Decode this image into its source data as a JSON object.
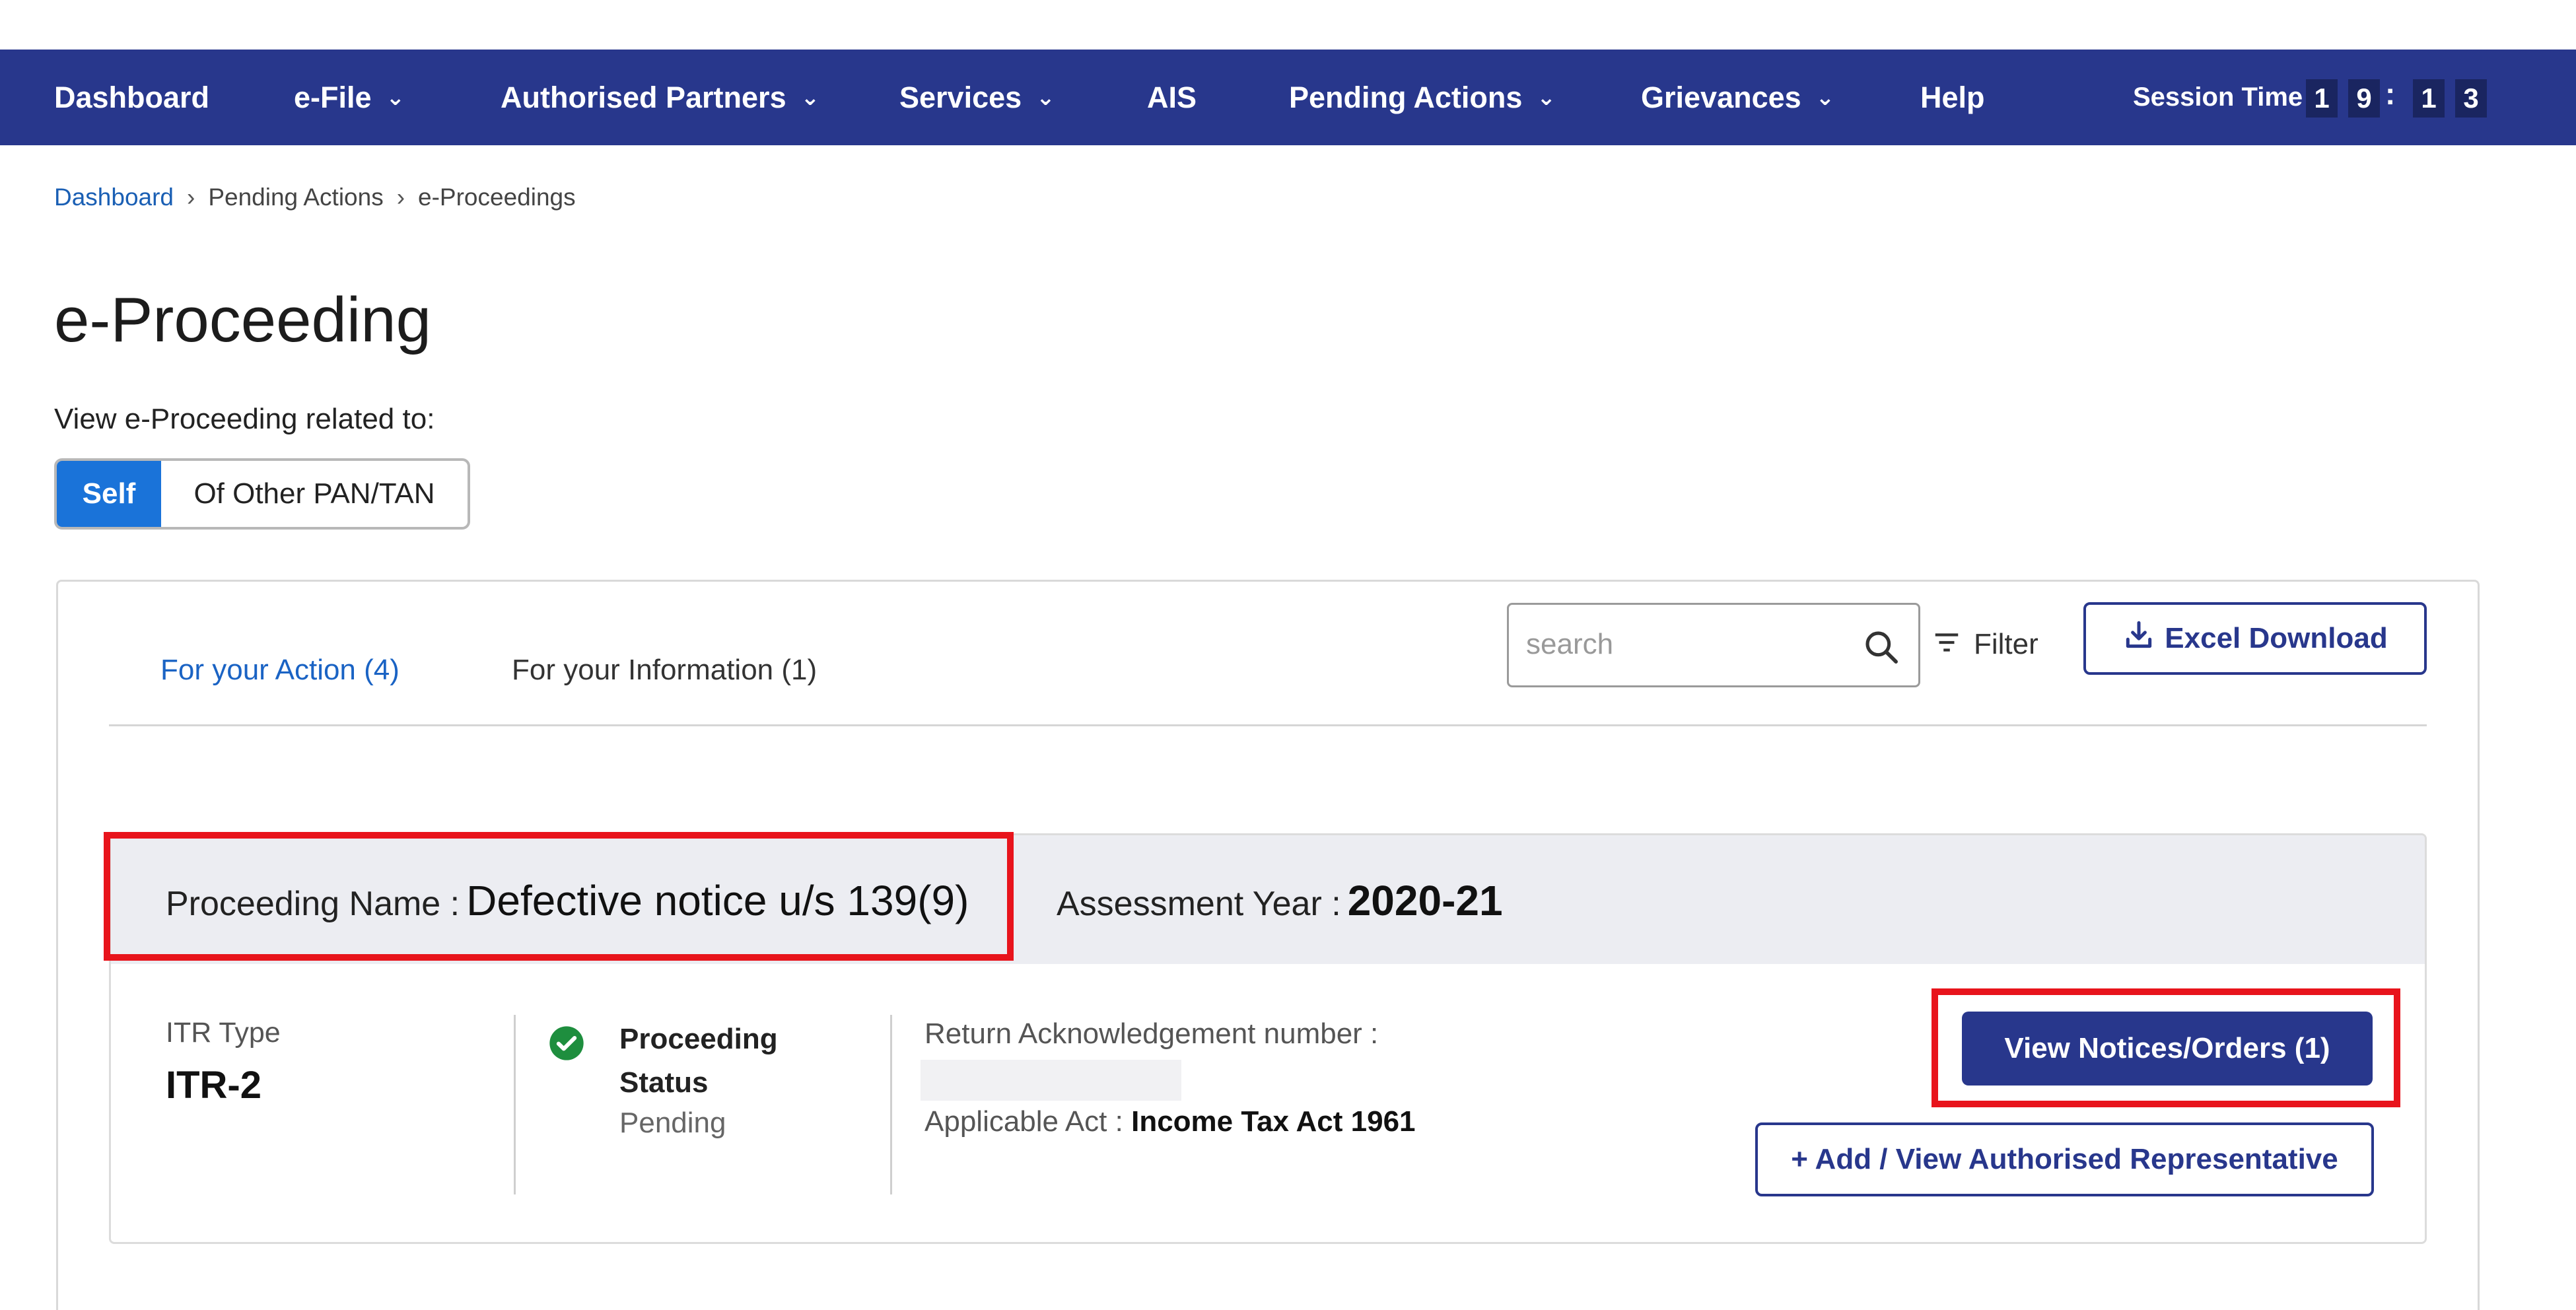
{
  "nav": {
    "items": [
      {
        "label": "Dashboard",
        "has_dropdown": false
      },
      {
        "label": "e-File",
        "has_dropdown": true
      },
      {
        "label": "Authorised Partners",
        "has_dropdown": true
      },
      {
        "label": "Services",
        "has_dropdown": true
      },
      {
        "label": "AIS",
        "has_dropdown": false
      },
      {
        "label": "Pending Actions",
        "has_dropdown": true
      },
      {
        "label": "Grievances",
        "has_dropdown": true
      },
      {
        "label": "Help",
        "has_dropdown": false
      }
    ],
    "session": {
      "label": "Session Time",
      "digits": [
        "1",
        "9",
        "1",
        "3"
      ],
      "separator": ":"
    }
  },
  "breadcrumb": {
    "items": [
      "Dashboard",
      "Pending Actions",
      "e-Proceedings"
    ],
    "separator": "›"
  },
  "page": {
    "title": "e-Proceeding",
    "view_label": "View e-Proceeding related to:"
  },
  "toggle": {
    "self": "Self",
    "other": "Of Other PAN/TAN"
  },
  "tabs": {
    "action": "For your Action (4)",
    "information": "For your Information (1)"
  },
  "toolbar": {
    "search_placeholder": "search",
    "filter": "Filter",
    "excel": "Excel Download"
  },
  "proceeding": {
    "name_label": "Proceeding Name :",
    "name_value": "Defective notice u/s 139(9)",
    "ay_label": "Assessment Year :",
    "ay_value": "2020-21",
    "itr_label": "ITR Type",
    "itr_value": "ITR-2",
    "status_label": "Proceeding Status",
    "status_value": "Pending",
    "ack_label": "Return Acknowledgement number :",
    "act_label": "Applicable Act :",
    "act_value": "Income Tax Act 1961",
    "notices_button": "View Notices/Orders (1)",
    "rep_button": "+ Add / View Authorised Representative"
  },
  "colors": {
    "nav_bg": "#28378c",
    "accent_blue": "#1a73d9",
    "highlight_red": "#e8141c",
    "status_green": "#1e8e3e"
  }
}
